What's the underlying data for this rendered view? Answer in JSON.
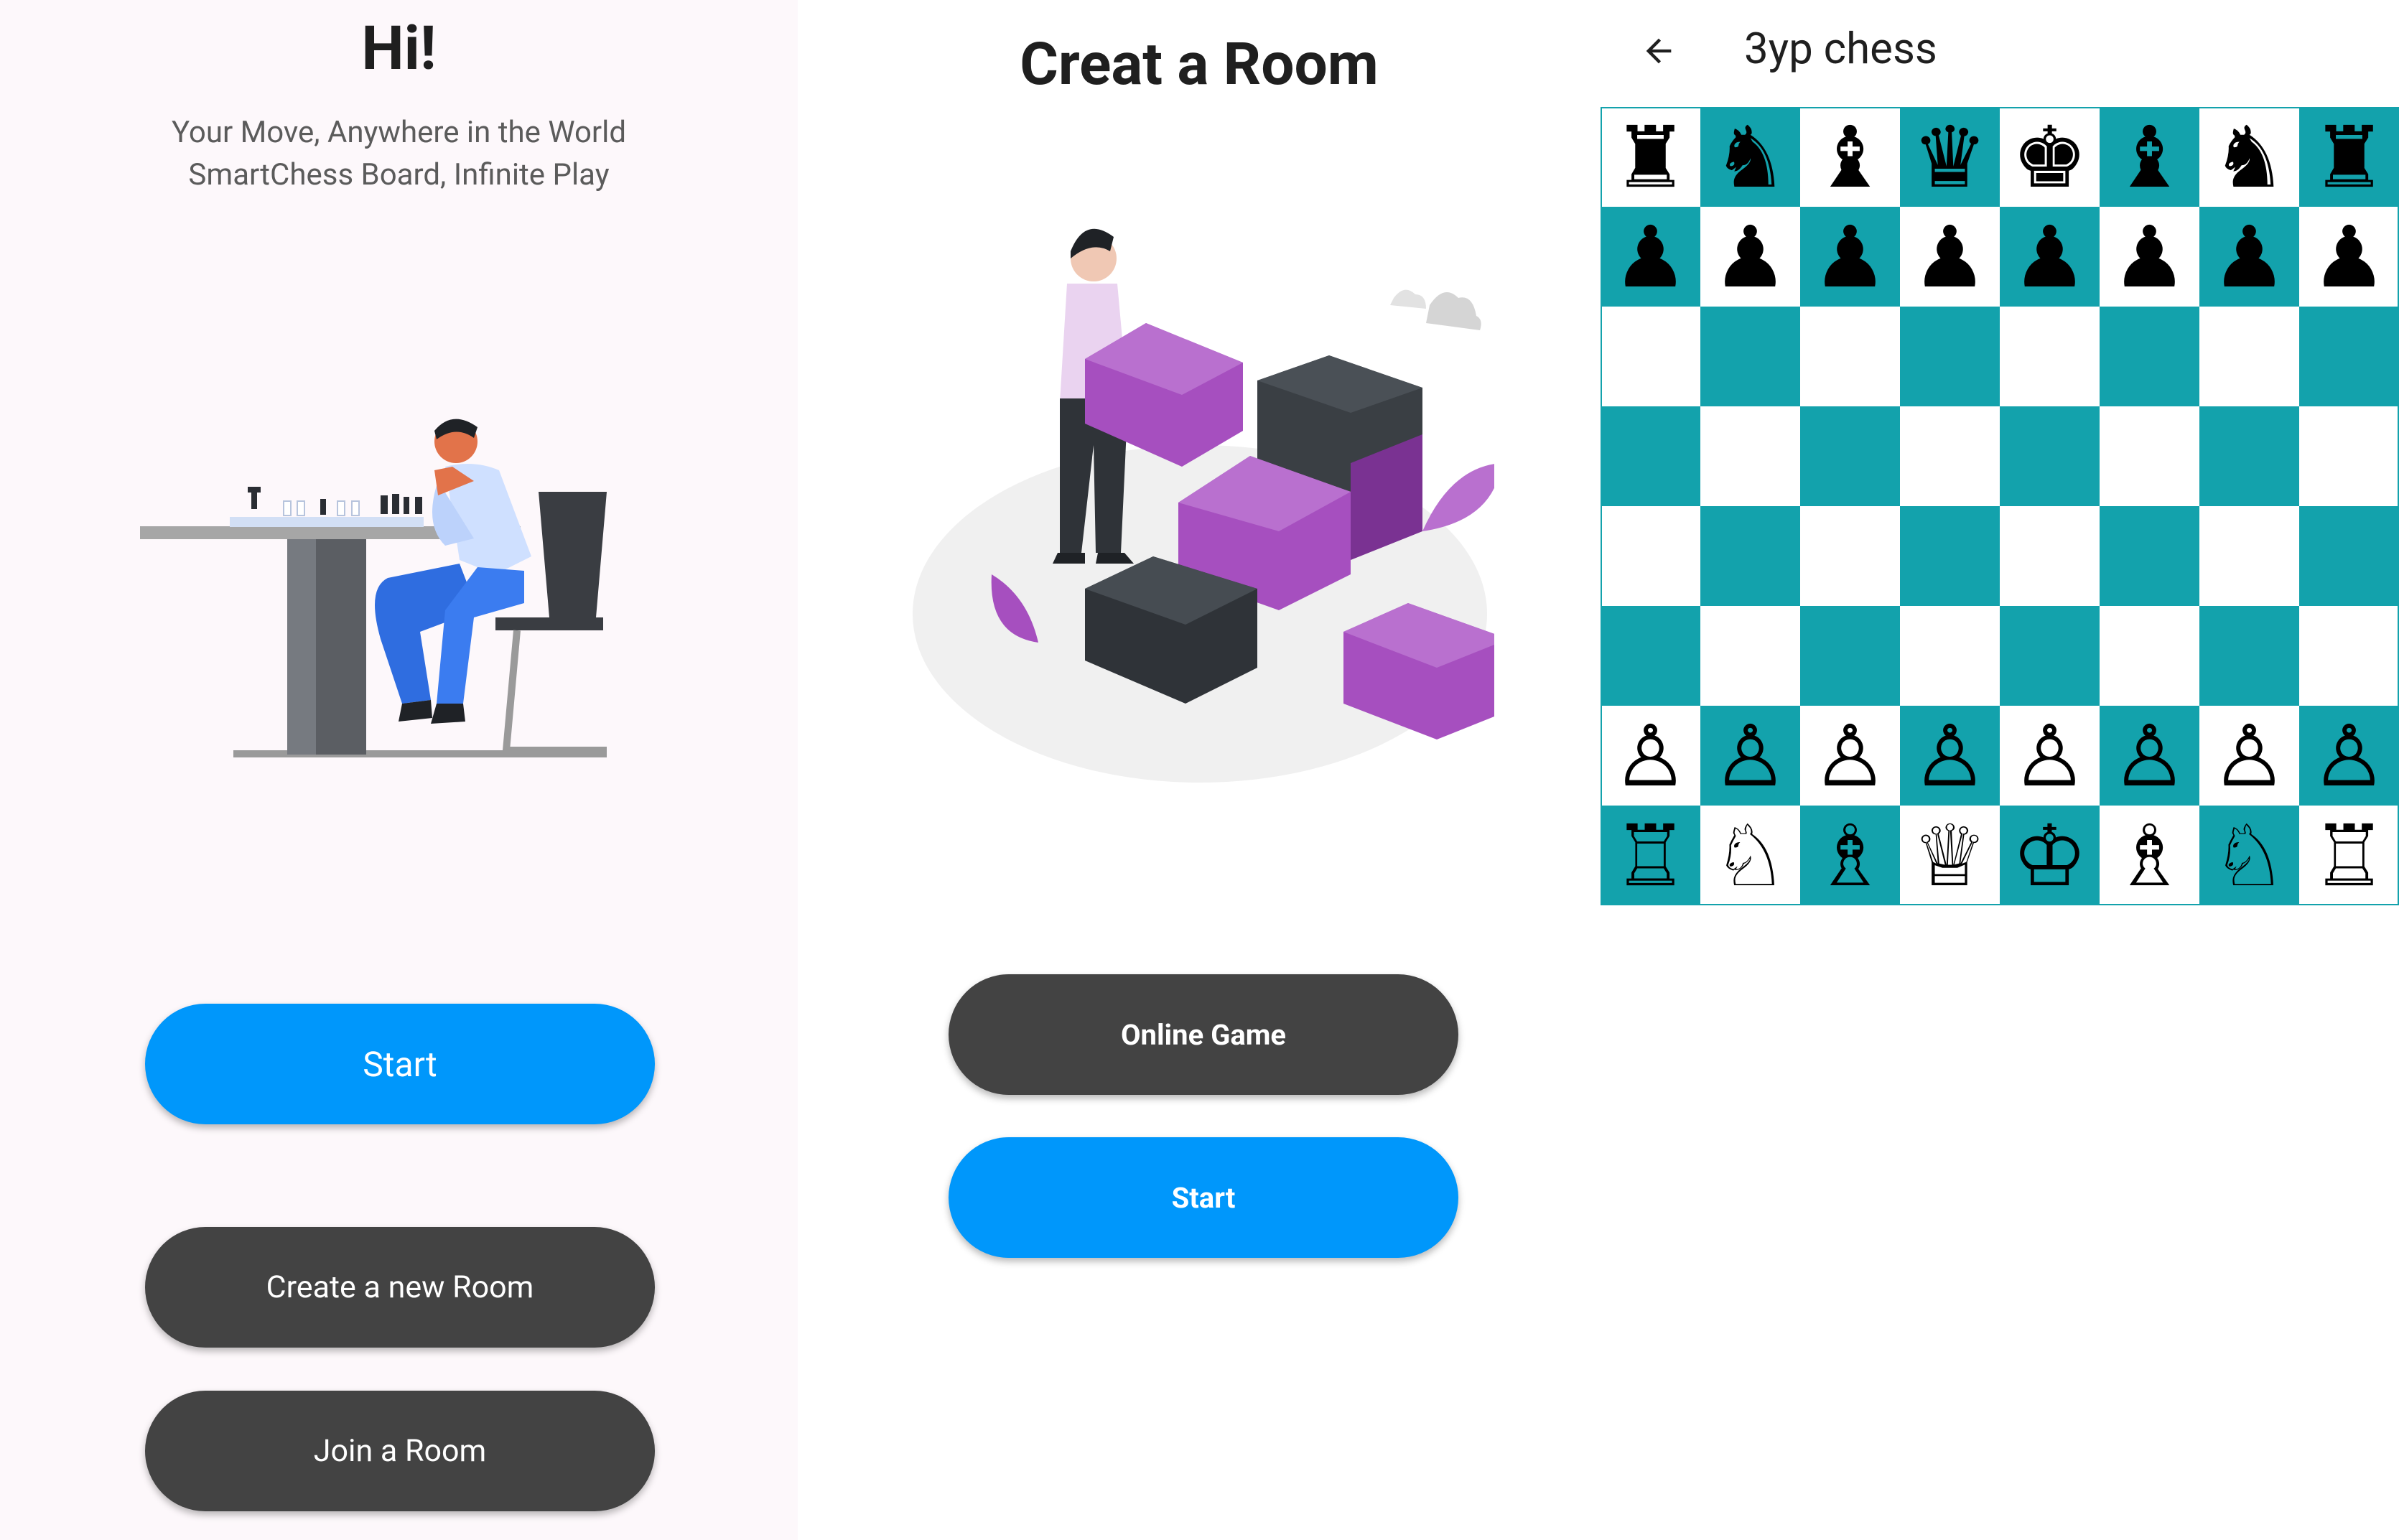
{
  "screen1": {
    "title": "Hi!",
    "subtitle_line1": "Your Move, Anywhere in the World",
    "subtitle_line2": "SmartChess Board, Infinite Play",
    "start_label": "Start",
    "create_room_label": "Create a new Room",
    "join_room_label": "Join a Room"
  },
  "screen2": {
    "title": "Creat a Room",
    "online_game_label": "Online Game",
    "start_label": "Start"
  },
  "screen3": {
    "app_bar_title": "3yp chess",
    "back_icon": "arrow-left-icon",
    "board": {
      "rows": [
        [
          "♜",
          "♞",
          "♝",
          "♛",
          "♚",
          "♝",
          "♞",
          "♜"
        ],
        [
          "♟",
          "♟",
          "♟",
          "♟",
          "♟",
          "♟",
          "♟",
          "♟"
        ],
        [
          "",
          "",
          "",
          "",
          "",
          "",
          "",
          ""
        ],
        [
          "",
          "",
          "",
          "",
          "",
          "",
          "",
          ""
        ],
        [
          "",
          "",
          "",
          "",
          "",
          "",
          "",
          ""
        ],
        [
          "",
          "",
          "",
          "",
          "",
          "",
          "",
          ""
        ],
        [
          "♙",
          "♙",
          "♙",
          "♙",
          "♙",
          "♙",
          "♙",
          "♙"
        ],
        [
          "♖",
          "♘",
          "♗",
          "♕",
          "♔",
          "♗",
          "♘",
          "♖"
        ]
      ]
    }
  },
  "colors": {
    "primary_blue": "#0097fb",
    "dark_button": "#434343",
    "board_teal": "#13a2ac",
    "board_light": "#ffffff",
    "illustration_purple": "#a64fbf",
    "illustration_dark": "#3a3f44"
  }
}
